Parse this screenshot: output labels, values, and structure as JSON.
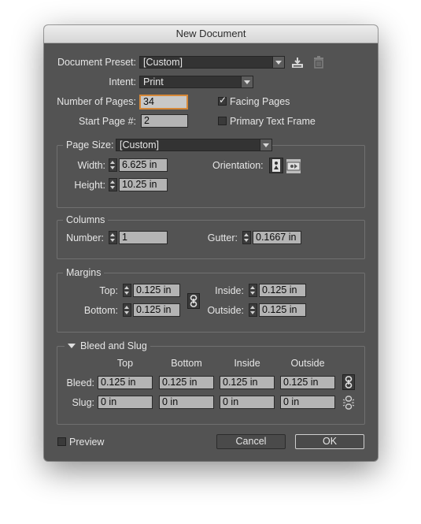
{
  "window": {
    "title": "New Document"
  },
  "preset": {
    "label": "Document Preset:",
    "value": "[Custom]"
  },
  "intent": {
    "label": "Intent:",
    "value": "Print"
  },
  "pages": {
    "count_label": "Number of Pages:",
    "count_value": "34",
    "start_label": "Start Page #:",
    "start_value": "2",
    "facing_label": "Facing Pages",
    "facing_checked": true,
    "primary_label": "Primary Text Frame",
    "primary_checked": false
  },
  "page_size": {
    "label": "Page Size:",
    "value": "[Custom]",
    "width_label": "Width:",
    "width_value": "6.625 in",
    "height_label": "Height:",
    "height_value": "10.25 in",
    "orientation_label": "Orientation:"
  },
  "columns": {
    "title": "Columns",
    "number_label": "Number:",
    "number_value": "1",
    "gutter_label": "Gutter:",
    "gutter_value": "0.1667 in"
  },
  "margins": {
    "title": "Margins",
    "top_label": "Top:",
    "top_value": "0.125 in",
    "bottom_label": "Bottom:",
    "bottom_value": "0.125 in",
    "inside_label": "Inside:",
    "inside_value": "0.125 in",
    "outside_label": "Outside:",
    "outside_value": "0.125 in"
  },
  "bleed_slug": {
    "title": "Bleed and Slug",
    "headers": [
      "Top",
      "Bottom",
      "Inside",
      "Outside"
    ],
    "bleed_label": "Bleed:",
    "bleed": [
      "0.125 in",
      "0.125 in",
      "0.125 in",
      "0.125 in"
    ],
    "slug_label": "Slug:",
    "slug": [
      "0 in",
      "0 in",
      "0 in",
      "0 in"
    ]
  },
  "footer": {
    "preview_label": "Preview",
    "cancel_label": "Cancel",
    "ok_label": "OK"
  }
}
